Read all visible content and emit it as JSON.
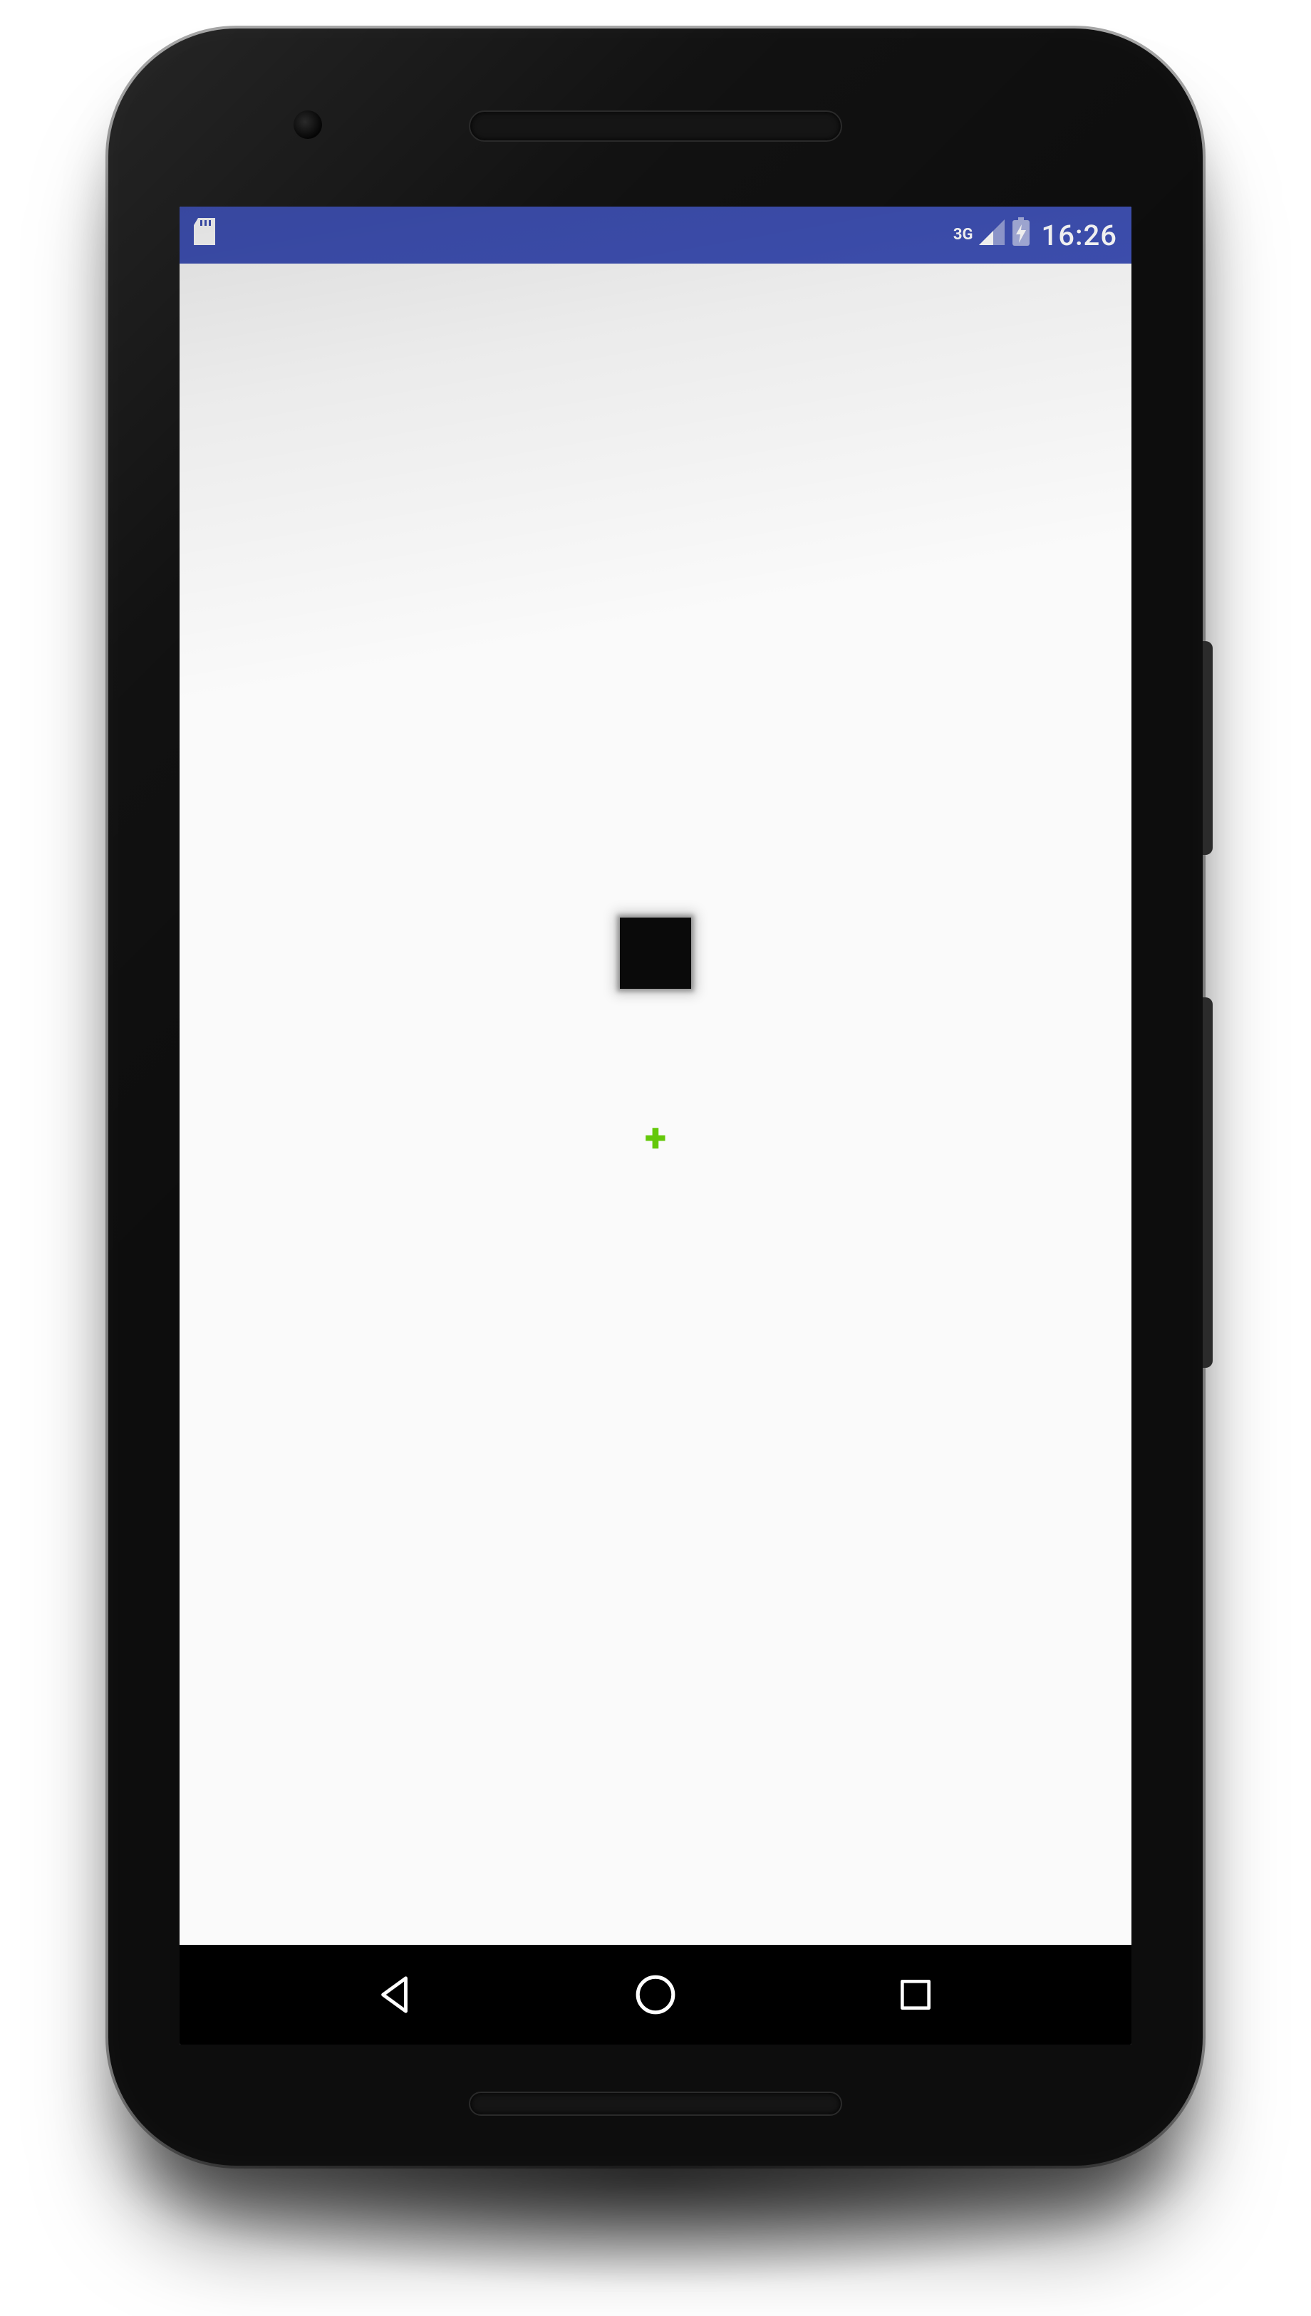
{
  "status_bar": {
    "network_label": "3G",
    "time": "16:26",
    "icons": {
      "sd_card": "sd-card-icon",
      "signal": "signal-icon",
      "battery": "battery-icon"
    },
    "background_color": "#3f51b5"
  },
  "app": {
    "black_block": {
      "color": "#0a0a0a"
    },
    "marker": {
      "symbol": "+",
      "color": "#64c80a"
    }
  },
  "nav_bar": {
    "back": "back-button",
    "home": "home-button",
    "recent": "recent-apps-button"
  }
}
